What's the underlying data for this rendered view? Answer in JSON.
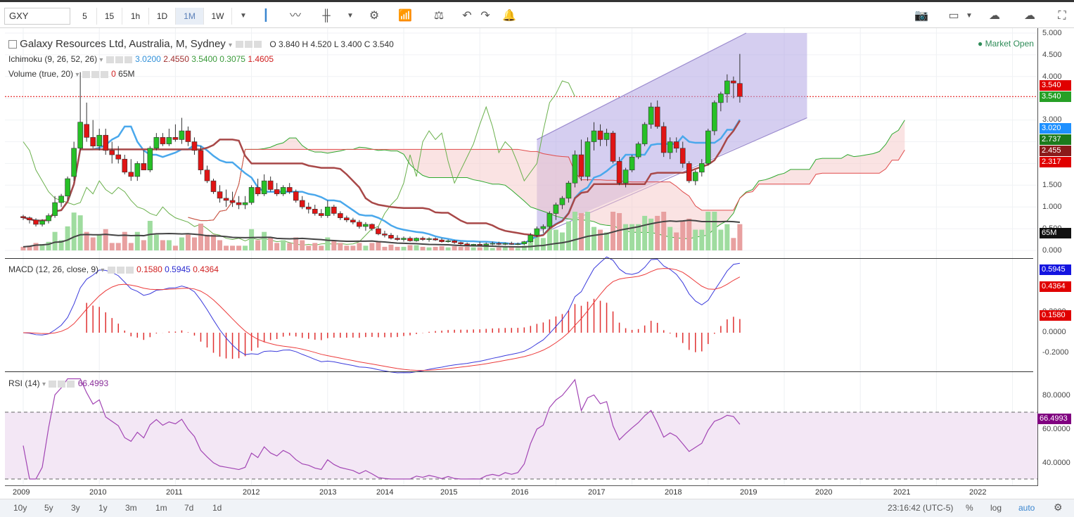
{
  "toolbar": {
    "symbol": "GXY",
    "intervals": [
      "5",
      "15",
      "1h",
      "1D",
      "1M",
      "1W"
    ],
    "active_interval": "1M"
  },
  "main_legend": {
    "title": "Galaxy Resources Ltd, Australia, M, Sydney",
    "o_label": "O",
    "o": "3.840",
    "h_label": "H",
    "h": "4.520",
    "l_label": "L",
    "l": "3.400",
    "c_label": "C",
    "c": "3.540",
    "status": "Market Open"
  },
  "ichimoku_legend": {
    "label": "Ichimoku (9, 26, 52, 26)",
    "v1": "3.0200",
    "v2": "2.4550",
    "v3": "3.5400",
    "v4": "0.3075",
    "v5": "1.4605"
  },
  "volume_legend": {
    "label": "Volume (true, 20)",
    "v1": "0",
    "v2": "65M"
  },
  "macd_legend": {
    "label": "MACD (12, 26, close, 9)",
    "v1": "0.1580",
    "v2": "0.5945",
    "v3": "0.4364"
  },
  "rsi_legend": {
    "label": "RSI (14)",
    "v1": "66.4993"
  },
  "price_axis": {
    "ticks": [
      "5.000",
      "4.500",
      "4.000",
      "3.500",
      "3.000",
      "2.500",
      "2.000",
      "1.500",
      "1.000",
      "0.500",
      "0.000"
    ],
    "tags": {
      "t1": "3.540",
      "t2": "3.540",
      "t3": "3.020",
      "t4": "2.737",
      "t5": "2.455",
      "t6": "2.317",
      "t7": "65M"
    }
  },
  "macd_axis": {
    "ticks": [
      "0.2000",
      "0.0000",
      "-0.2000"
    ],
    "tags": {
      "m1": "0.5945",
      "m2": "0.4364",
      "m3": "0.1580"
    }
  },
  "rsi_axis": {
    "ticks": [
      "80.0000",
      "60.0000",
      "40.0000"
    ],
    "tag": "66.4993"
  },
  "time_axis": [
    "2009",
    "2010",
    "2011",
    "2012",
    "2013",
    "2014",
    "2015",
    "2016",
    "2017",
    "2018",
    "2019",
    "2020",
    "2021",
    "2022"
  ],
  "bottom_bar": {
    "ranges": [
      "10y",
      "5y",
      "3y",
      "1y",
      "3m",
      "1m",
      "7d",
      "1d"
    ],
    "clock": "23:16:42 (UTC-5)",
    "pct": "%",
    "log": "log",
    "auto": "auto"
  },
  "colors": {
    "up": "#26c026",
    "down": "#e01414",
    "tenkan": "#4aa8ec",
    "kijun": "#a84848",
    "macd": "#3b3bdc",
    "signal": "#ec3b3b",
    "rsi": "#a245b4",
    "channel": "#9c8ccf"
  },
  "chart_data": [
    {
      "type": "candlestick",
      "title": "Galaxy Resources Ltd, Australia, M, Sydney",
      "ylim": [
        0,
        5
      ],
      "x_range": [
        "2009-01",
        "2022-12"
      ],
      "candles": [
        [
          "2009-01",
          0.78,
          0.82,
          0.7,
          0.75
        ],
        [
          "2009-02",
          0.75,
          0.78,
          0.62,
          0.7
        ],
        [
          "2009-03",
          0.7,
          0.74,
          0.55,
          0.6
        ],
        [
          "2009-04",
          0.6,
          0.72,
          0.55,
          0.68
        ],
        [
          "2009-05",
          0.68,
          0.85,
          0.62,
          0.8
        ],
        [
          "2009-06",
          0.8,
          1.25,
          0.75,
          1.1
        ],
        [
          "2009-07",
          1.1,
          1.3,
          1.0,
          1.25
        ],
        [
          "2009-08",
          1.25,
          1.7,
          1.15,
          1.65
        ],
        [
          "2009-09",
          1.7,
          2.5,
          1.6,
          2.35
        ],
        [
          "2009-10",
          2.35,
          4.1,
          2.3,
          2.95
        ],
        [
          "2009-11",
          2.9,
          3.4,
          2.5,
          2.6
        ],
        [
          "2009-12",
          2.6,
          3.0,
          2.35,
          2.4
        ],
        [
          "2010-01",
          2.4,
          2.8,
          2.3,
          2.65
        ],
        [
          "2010-02",
          2.65,
          2.8,
          2.2,
          2.3
        ],
        [
          "2010-03",
          2.3,
          2.5,
          2.0,
          2.2
        ],
        [
          "2010-04",
          2.2,
          2.4,
          2.0,
          2.1
        ],
        [
          "2010-05",
          2.1,
          2.2,
          1.75,
          1.8
        ],
        [
          "2010-06",
          1.8,
          2.1,
          1.6,
          1.7
        ],
        [
          "2010-07",
          1.7,
          2.05,
          1.6,
          2.0
        ],
        [
          "2010-08",
          2.0,
          2.3,
          1.85,
          1.85
        ],
        [
          "2010-09",
          1.85,
          2.4,
          1.8,
          2.35
        ],
        [
          "2010-10",
          2.35,
          2.7,
          2.3,
          2.6
        ],
        [
          "2010-11",
          2.6,
          2.7,
          2.4,
          2.45
        ],
        [
          "2010-12",
          2.45,
          2.8,
          2.4,
          2.6
        ],
        [
          "2011-01",
          2.6,
          2.9,
          2.5,
          2.55
        ],
        [
          "2011-02",
          2.55,
          3.05,
          2.45,
          2.75
        ],
        [
          "2011-03",
          2.75,
          2.85,
          2.4,
          2.5
        ],
        [
          "2011-04",
          2.5,
          2.6,
          2.2,
          2.3
        ],
        [
          "2011-05",
          2.3,
          2.4,
          1.75,
          1.85
        ],
        [
          "2011-06",
          1.85,
          1.95,
          1.55,
          1.6
        ],
        [
          "2011-07",
          1.6,
          1.65,
          1.3,
          1.35
        ],
        [
          "2011-08",
          1.35,
          1.5,
          1.1,
          1.2
        ],
        [
          "2011-09",
          1.2,
          1.4,
          1.0,
          1.15
        ],
        [
          "2011-10",
          1.15,
          1.35,
          1.0,
          1.1
        ],
        [
          "2011-11",
          1.1,
          1.25,
          0.95,
          1.05
        ],
        [
          "2011-12",
          1.05,
          1.25,
          0.95,
          1.1
        ],
        [
          "2012-01",
          1.1,
          1.5,
          1.05,
          1.45
        ],
        [
          "2012-02",
          1.45,
          1.65,
          1.25,
          1.3
        ],
        [
          "2012-03",
          1.3,
          1.75,
          1.25,
          1.6
        ],
        [
          "2012-04",
          1.6,
          1.7,
          1.35,
          1.4
        ],
        [
          "2012-05",
          1.4,
          1.55,
          1.25,
          1.3
        ],
        [
          "2012-06",
          1.3,
          1.5,
          1.25,
          1.45
        ],
        [
          "2012-07",
          1.45,
          1.55,
          1.3,
          1.35
        ],
        [
          "2012-08",
          1.35,
          1.4,
          1.1,
          1.15
        ],
        [
          "2012-09",
          1.15,
          1.25,
          0.95,
          1.0
        ],
        [
          "2012-10",
          1.0,
          1.1,
          0.85,
          0.95
        ],
        [
          "2012-11",
          0.95,
          1.05,
          0.8,
          0.85
        ],
        [
          "2012-12",
          0.85,
          0.95,
          0.75,
          0.8
        ],
        [
          "2013-01",
          0.8,
          1.15,
          0.75,
          1.0
        ],
        [
          "2013-02",
          1.0,
          1.05,
          0.8,
          0.85
        ],
        [
          "2013-03",
          0.85,
          0.9,
          0.7,
          0.75
        ],
        [
          "2013-04",
          0.75,
          0.8,
          0.65,
          0.7
        ],
        [
          "2013-05",
          0.7,
          0.75,
          0.6,
          0.65
        ],
        [
          "2013-06",
          0.65,
          0.7,
          0.5,
          0.55
        ],
        [
          "2013-07",
          0.55,
          0.65,
          0.45,
          0.6
        ],
        [
          "2013-08",
          0.6,
          0.62,
          0.45,
          0.5
        ],
        [
          "2013-09",
          0.5,
          0.55,
          0.35,
          0.38
        ],
        [
          "2013-10",
          0.38,
          0.45,
          0.3,
          0.35
        ],
        [
          "2013-11",
          0.35,
          0.4,
          0.25,
          0.28
        ],
        [
          "2013-12",
          0.28,
          0.35,
          0.22,
          0.25
        ],
        [
          "2014-01",
          0.25,
          0.32,
          0.2,
          0.28
        ],
        [
          "2014-02",
          0.28,
          0.32,
          0.2,
          0.22
        ],
        [
          "2014-03",
          0.22,
          0.3,
          0.2,
          0.28
        ],
        [
          "2014-04",
          0.28,
          0.32,
          0.22,
          0.25
        ],
        [
          "2014-05",
          0.25,
          0.3,
          0.2,
          0.27
        ],
        [
          "2014-06",
          0.27,
          0.3,
          0.22,
          0.24
        ],
        [
          "2014-07",
          0.24,
          0.28,
          0.18,
          0.2
        ],
        [
          "2014-08",
          0.2,
          0.25,
          0.18,
          0.22
        ],
        [
          "2014-09",
          0.22,
          0.24,
          0.15,
          0.18
        ],
        [
          "2014-10",
          0.18,
          0.2,
          0.12,
          0.15
        ],
        [
          "2014-11",
          0.15,
          0.18,
          0.1,
          0.12
        ],
        [
          "2014-12",
          0.12,
          0.15,
          0.1,
          0.14
        ],
        [
          "2015-01",
          0.14,
          0.2,
          0.1,
          0.12
        ],
        [
          "2015-02",
          0.12,
          0.18,
          0.1,
          0.15
        ],
        [
          "2015-03",
          0.15,
          0.2,
          0.12,
          0.16
        ],
        [
          "2015-04",
          0.16,
          0.2,
          0.12,
          0.14
        ],
        [
          "2015-05",
          0.14,
          0.18,
          0.12,
          0.16
        ],
        [
          "2015-06",
          0.16,
          0.2,
          0.13,
          0.14
        ],
        [
          "2015-07",
          0.14,
          0.18,
          0.12,
          0.15
        ],
        [
          "2015-08",
          0.15,
          0.22,
          0.12,
          0.2
        ],
        [
          "2015-09",
          0.2,
          0.4,
          0.18,
          0.35
        ],
        [
          "2015-10",
          0.35,
          0.55,
          0.3,
          0.5
        ],
        [
          "2015-11",
          0.5,
          0.6,
          0.4,
          0.55
        ],
        [
          "2015-12",
          0.55,
          0.9,
          0.5,
          0.85
        ],
        [
          "2016-01",
          0.85,
          1.1,
          0.7,
          1.05
        ],
        [
          "2016-02",
          1.05,
          1.25,
          0.95,
          1.2
        ],
        [
          "2016-03",
          1.2,
          1.6,
          1.1,
          1.55
        ],
        [
          "2016-04",
          1.55,
          2.3,
          1.45,
          2.2
        ],
        [
          "2016-05",
          2.2,
          2.55,
          1.6,
          1.7
        ],
        [
          "2016-06",
          1.7,
          2.6,
          1.6,
          2.5
        ],
        [
          "2016-07",
          2.5,
          2.95,
          2.3,
          2.75
        ],
        [
          "2016-08",
          2.75,
          2.9,
          2.4,
          2.55
        ],
        [
          "2016-09",
          2.55,
          2.8,
          2.4,
          2.7
        ],
        [
          "2016-10",
          2.7,
          2.75,
          2.0,
          2.05
        ],
        [
          "2016-11",
          2.05,
          2.15,
          1.5,
          1.55
        ],
        [
          "2016-12",
          1.55,
          1.9,
          1.45,
          1.85
        ],
        [
          "2017-01",
          1.85,
          2.2,
          1.8,
          2.15
        ],
        [
          "2017-02",
          2.15,
          2.5,
          2.1,
          2.45
        ],
        [
          "2017-03",
          2.45,
          2.95,
          2.4,
          2.9
        ],
        [
          "2017-04",
          2.9,
          3.4,
          2.8,
          3.3
        ],
        [
          "2017-05",
          3.3,
          3.45,
          2.8,
          2.85
        ],
        [
          "2017-06",
          2.85,
          2.95,
          2.15,
          2.25
        ],
        [
          "2017-07",
          2.25,
          2.6,
          2.1,
          2.5
        ],
        [
          "2017-08",
          2.5,
          2.6,
          2.25,
          2.35
        ],
        [
          "2017-09",
          2.35,
          2.5,
          1.9,
          2.0
        ],
        [
          "2017-10",
          2.0,
          2.05,
          1.55,
          1.6
        ],
        [
          "2017-11",
          1.6,
          1.85,
          1.5,
          1.8
        ],
        [
          "2017-12",
          1.8,
          2.1,
          1.7,
          2.0
        ],
        [
          "2018-01",
          2.0,
          2.8,
          1.95,
          2.75
        ],
        [
          "2018-02",
          2.75,
          3.45,
          2.65,
          3.4
        ],
        [
          "2018-03",
          3.4,
          3.65,
          3.2,
          3.6
        ],
        [
          "2018-04",
          3.6,
          4.05,
          3.4,
          3.9
        ],
        [
          "2018-05",
          3.9,
          4.0,
          3.5,
          3.85
        ],
        [
          "2018-06",
          3.84,
          4.52,
          3.4,
          3.54
        ]
      ],
      "ichimoku": {
        "tenkan_last": 3.02,
        "kijun_last": 2.455,
        "cloud_last": [
          2.737,
          2.317
        ]
      },
      "volume": {
        "last_label": "65M"
      },
      "channel": {
        "upper_start": [
          2015.75,
          2.5
        ],
        "upper_end": [
          2018.5,
          5.0
        ],
        "lower_end": [
          2019.3,
          3.05
        ]
      }
    },
    {
      "type": "line",
      "title": "MACD (12, 26, close, 9)",
      "ylim": [
        -0.3,
        0.7
      ],
      "series": [
        {
          "name": "MACD",
          "last": 0.5945
        },
        {
          "name": "Signal",
          "last": 0.4364
        },
        {
          "name": "Histogram",
          "last": 0.158
        }
      ]
    },
    {
      "type": "line",
      "title": "RSI (14)",
      "ylim": [
        30,
        90
      ],
      "bands": [
        30,
        70
      ],
      "series": [
        {
          "name": "RSI",
          "last": 66.4993
        }
      ]
    }
  ]
}
